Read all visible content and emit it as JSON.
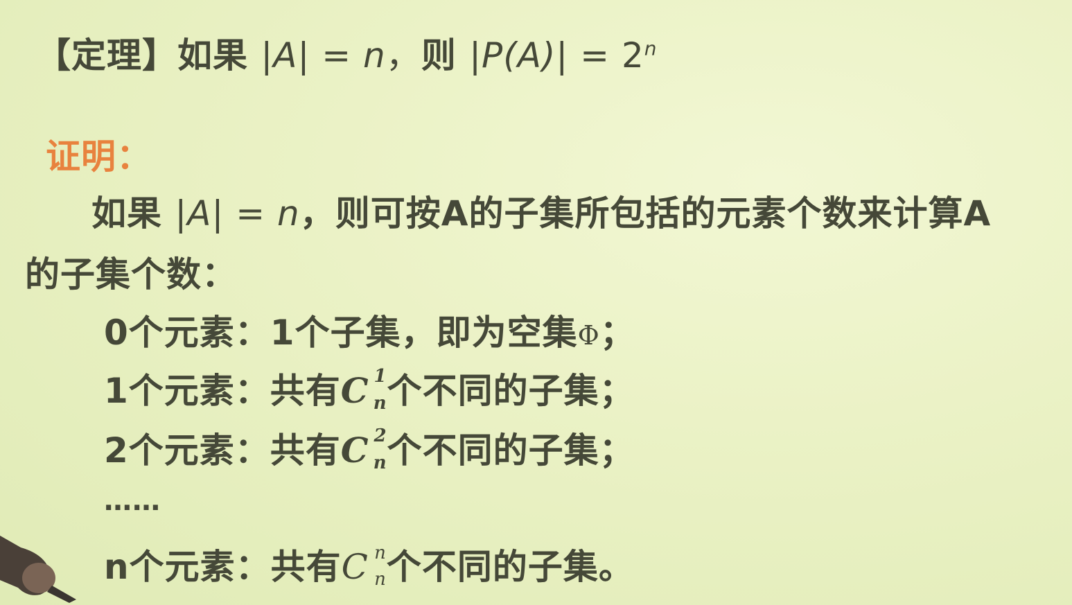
{
  "theorem": {
    "bracket_label": "【定理】",
    "if_word": "如果",
    "cond_open": "|",
    "cond_var": "A",
    "cond_close": "|",
    "cond_eq": " = ",
    "cond_n": "n",
    "comma": "，",
    "then_word": "则",
    "result_open": "|",
    "result_P": "P",
    "result_arg": "(A)",
    "result_close": "|",
    "result_eq": " = ",
    "result_base": "2",
    "result_exp": "n"
  },
  "proof": {
    "label": "证明："
  },
  "paragraph": {
    "lead": "如果",
    "abs_open": "|",
    "abs_var": "A",
    "abs_close": "|",
    "eq": " = ",
    "n": "n",
    "rest": "，则可按A的子集所包括的元素个数来计算A",
    "line2": "的子集个数："
  },
  "cases": [
    {
      "count": "0",
      "prefix": "个元素：",
      "text": "1个子集，即为空集",
      "symbol": "Φ",
      "end": "；"
    },
    {
      "count": "1",
      "prefix": "个元素：",
      "before": "共有",
      "C": "C",
      "sup": "1",
      "sub": "n",
      "after": "个不同的子集；"
    },
    {
      "count": "2",
      "prefix": "个元素：",
      "before": "共有",
      "C": "C",
      "sup": "2",
      "sub": "n",
      "after": "个不同的子集；"
    }
  ],
  "ellipsis": "……",
  "last_case": {
    "count": "n",
    "prefix": "个元素：",
    "before": "共有",
    "C": "C",
    "sup": "n",
    "sub": "n",
    "after": "个不同的子集。"
  },
  "colors": {
    "background": "#ebf2c6",
    "text": "#454838",
    "proof_label": "#e8823e"
  }
}
